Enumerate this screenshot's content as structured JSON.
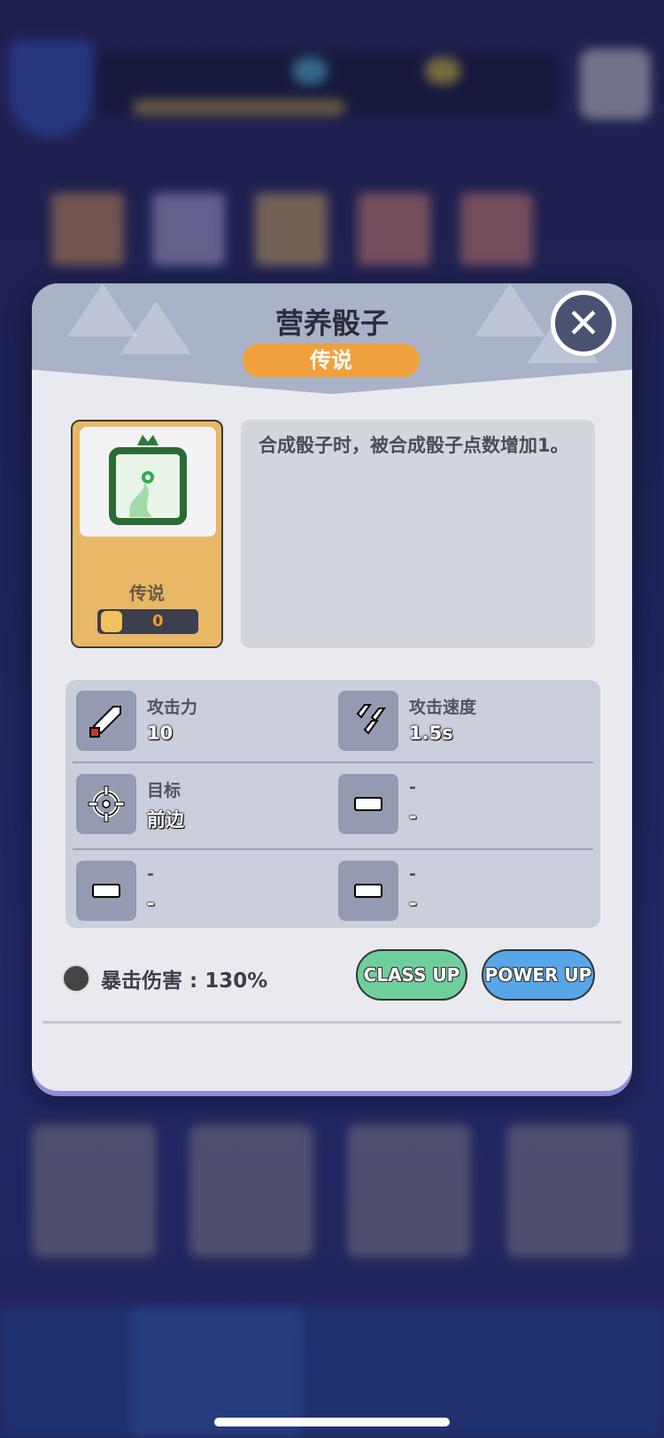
{
  "modal": {
    "title": "营养骰子",
    "rarity_badge": "传说",
    "close_icon": "close-icon",
    "colors": {
      "rarity_orange": "#f1a13b",
      "class_up_green": "#6fcf9a",
      "power_up_blue": "#57a6e8"
    }
  },
  "dice": {
    "rarity": "传说",
    "count": "0",
    "icon": "green-dragon-dice-icon"
  },
  "description": "合成骰子时，被合成骰子点数增加1。",
  "stats": [
    {
      "label": "攻击力",
      "value": "10",
      "icon": "sword-icon"
    },
    {
      "label": "攻击速度",
      "value": "1.5s",
      "icon": "triple-sword-icon"
    },
    {
      "label": "目标",
      "value": "前边",
      "icon": "crosshair-icon"
    },
    {
      "label": "-",
      "value": "-",
      "icon": "dash-icon"
    },
    {
      "label": "-",
      "value": "-",
      "icon": "dash-icon"
    },
    {
      "label": "-",
      "value": "-",
      "icon": "dash-icon"
    }
  ],
  "crit": {
    "text": "暴击伤害 : 130%",
    "icon": "crit-icon"
  },
  "buttons": {
    "class_up": "CLASS UP",
    "power_up": "POWER UP"
  }
}
